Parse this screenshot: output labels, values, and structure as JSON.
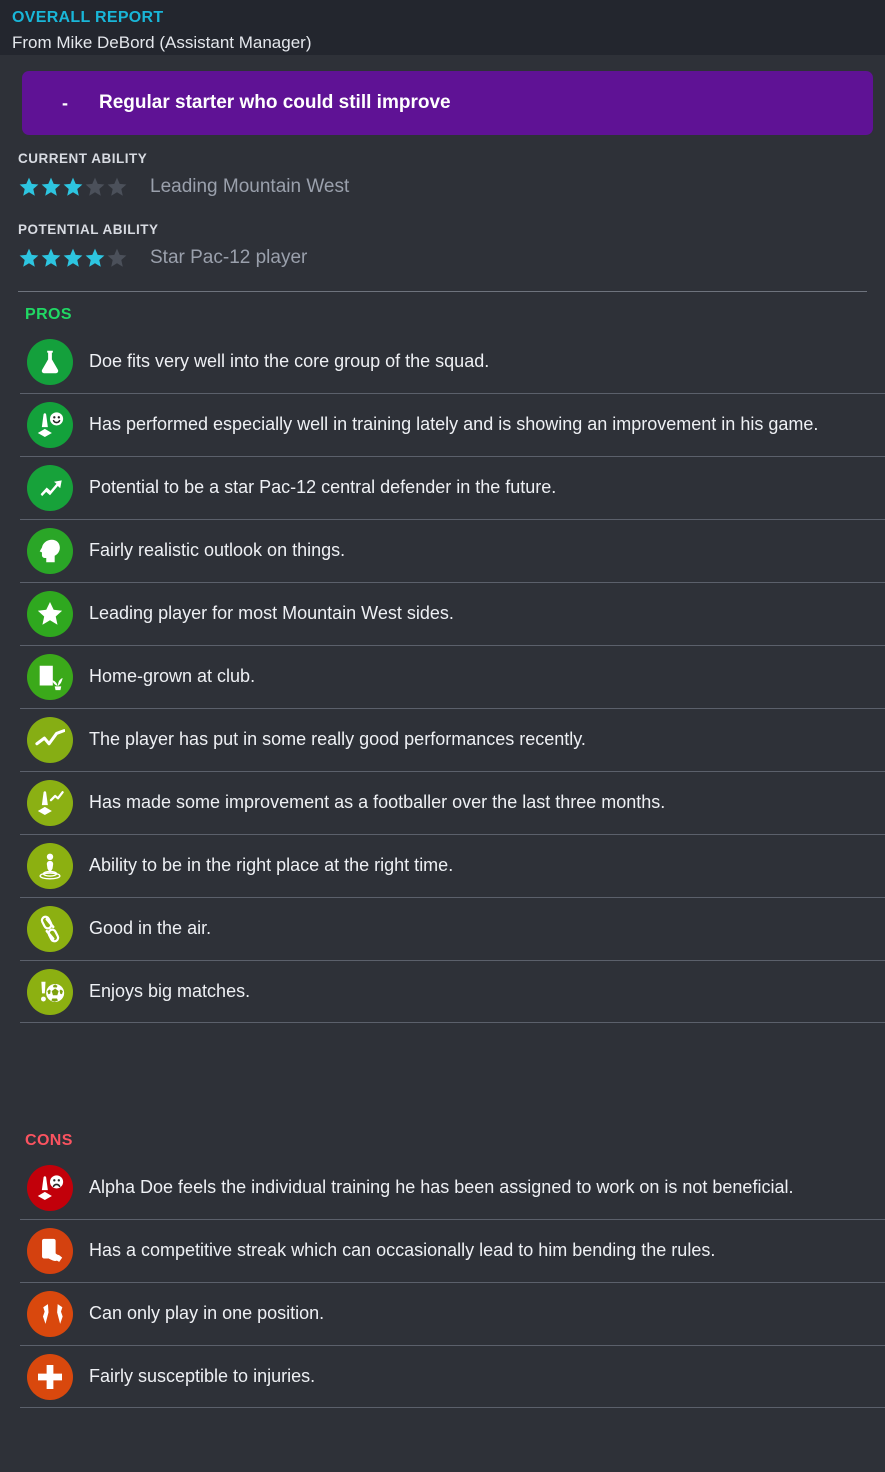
{
  "header": {
    "kicker": "OVERALL REPORT",
    "from": "From Mike DeBord (Assistant Manager)"
  },
  "verdict": {
    "bullet": "-",
    "text": "Regular starter who could still improve",
    "color": "#5f1295"
  },
  "ratings": {
    "current": {
      "label": "CURRENT ABILITY",
      "filled": 3,
      "total": 5,
      "description": "Leading Mountain West"
    },
    "potential": {
      "label": "POTENTIAL ABILITY",
      "filled": 4,
      "total": 5,
      "description": "Star Pac-12 player"
    },
    "star_filled_color": "#2dc5e0",
    "star_empty_color": "#4b505a"
  },
  "pros": {
    "title": "PROS",
    "title_color": "#20d864",
    "items": [
      {
        "icon": "flask-icon",
        "color": "#14a03c",
        "text": "Doe fits very well into the core group of the squad."
      },
      {
        "icon": "training-happy-icon",
        "color": "#13a13b",
        "text": "Has performed especially well in training lately and is showing an improvement in his game."
      },
      {
        "icon": "trend-up-arrow-icon",
        "color": "#17a23a",
        "text": "Potential to be a star Pac-12 central defender in the future."
      },
      {
        "icon": "head-target-icon",
        "color": "#2aa627",
        "text": "Fairly realistic outlook on things."
      },
      {
        "icon": "star-icon",
        "color": "#2fa81f",
        "text": "Leading player for most Mountain West sides."
      },
      {
        "icon": "homegrown-plant-icon",
        "color": "#3ba91a",
        "text": "Home-grown at club."
      },
      {
        "icon": "form-graph-icon",
        "color": "#86ae14",
        "text": "The player has put in some really good performances recently."
      },
      {
        "icon": "training-progress-icon",
        "color": "#8bb013",
        "text": "Has made some improvement as a footballer over the last three months."
      },
      {
        "icon": "positioning-icon",
        "color": "#8cb011",
        "text": "Ability to be in the right place at the right time."
      },
      {
        "icon": "heading-icon",
        "color": "#8cb011",
        "text": "Good in the air."
      },
      {
        "icon": "big-match-ball-icon",
        "color": "#8cb011",
        "text": "Enjoys big matches."
      }
    ]
  },
  "cons": {
    "title": "CONS",
    "title_color": "#fb5360",
    "items": [
      {
        "icon": "training-unhappy-icon",
        "color": "#c2000a",
        "text": "Alpha Doe feels the individual training he has been assigned to work on is not beneficial."
      },
      {
        "icon": "card-hand-icon",
        "color": "#d4410f",
        "text": "Has a competitive streak which can occasionally lead to him bending the rules."
      },
      {
        "icon": "position-arrows-icon",
        "color": "#d9480d",
        "text": "Can only play in one position."
      },
      {
        "icon": "injury-cross-icon",
        "color": "#d9480d",
        "text": "Fairly susceptible to injuries."
      }
    ]
  }
}
